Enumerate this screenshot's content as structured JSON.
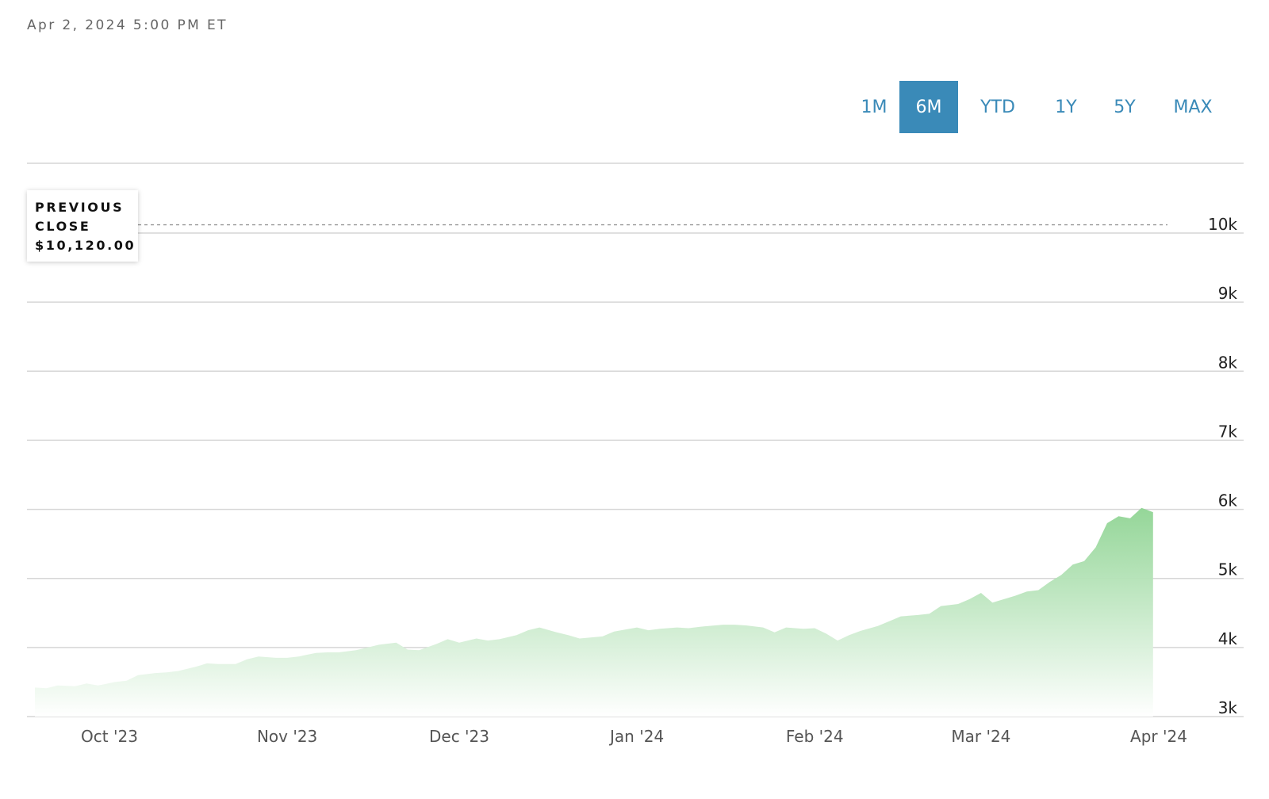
{
  "header": {
    "timestamp": "Apr 2, 2024 5:00 PM ET"
  },
  "range_tabs": [
    {
      "label": "1M",
      "active": false
    },
    {
      "label": "6M",
      "active": true
    },
    {
      "label": "YTD",
      "active": false
    },
    {
      "label": "1Y",
      "active": false
    },
    {
      "label": "5Y",
      "active": false
    },
    {
      "label": "MAX",
      "active": false
    }
  ],
  "tooltip": {
    "line1": "PREVIOUS",
    "line2": "CLOSE",
    "value": "$10,120.00"
  },
  "colors": {
    "accent": "#3a8ab8",
    "area_top": "#8fd493",
    "area_bottom": "#ffffff",
    "grid": "#d6d6d6",
    "reference_line": "#9a9a9a"
  },
  "chart_data": {
    "type": "area",
    "title": "",
    "xlabel": "",
    "ylabel": "",
    "ylim": [
      3000,
      11000
    ],
    "y_ticks": [
      3000,
      4000,
      5000,
      6000,
      7000,
      8000,
      9000,
      10000
    ],
    "y_tick_labels": [
      "3k",
      "4k",
      "5k",
      "6k",
      "7k",
      "8k",
      "9k",
      "10k"
    ],
    "x_ticks": [
      {
        "date": "2023-10-01",
        "label": "Oct '23"
      },
      {
        "date": "2023-11-01",
        "label": "Nov '23"
      },
      {
        "date": "2023-12-01",
        "label": "Dec '23"
      },
      {
        "date": "2024-01-01",
        "label": "Jan '24"
      },
      {
        "date": "2024-02-01",
        "label": "Feb '24"
      },
      {
        "date": "2024-03-01",
        "label": "Mar '24"
      },
      {
        "date": "2024-04-01",
        "label": "Apr '24"
      }
    ],
    "reference_line": {
      "label": "PREVIOUS CLOSE",
      "value": 10120
    },
    "grid": true,
    "series": [
      {
        "points": [
          [
            "2023-09-18",
            3420
          ],
          [
            "2023-09-20",
            3410
          ],
          [
            "2023-09-22",
            3450
          ],
          [
            "2023-09-25",
            3440
          ],
          [
            "2023-09-27",
            3480
          ],
          [
            "2023-09-29",
            3450
          ],
          [
            "2023-10-02",
            3500
          ],
          [
            "2023-10-04",
            3520
          ],
          [
            "2023-10-06",
            3600
          ],
          [
            "2023-10-09",
            3630
          ],
          [
            "2023-10-11",
            3640
          ],
          [
            "2023-10-13",
            3660
          ],
          [
            "2023-10-16",
            3720
          ],
          [
            "2023-10-18",
            3770
          ],
          [
            "2023-10-20",
            3760
          ],
          [
            "2023-10-23",
            3760
          ],
          [
            "2023-10-25",
            3830
          ],
          [
            "2023-10-27",
            3870
          ],
          [
            "2023-10-30",
            3850
          ],
          [
            "2023-11-01",
            3850
          ],
          [
            "2023-11-03",
            3870
          ],
          [
            "2023-11-06",
            3920
          ],
          [
            "2023-11-08",
            3930
          ],
          [
            "2023-11-10",
            3930
          ],
          [
            "2023-11-13",
            3960
          ],
          [
            "2023-11-15",
            4000
          ],
          [
            "2023-11-17",
            4040
          ],
          [
            "2023-11-20",
            4070
          ],
          [
            "2023-11-22",
            3970
          ],
          [
            "2023-11-24",
            3960
          ],
          [
            "2023-11-27",
            4050
          ],
          [
            "2023-11-29",
            4120
          ],
          [
            "2023-12-01",
            4070
          ],
          [
            "2023-12-04",
            4130
          ],
          [
            "2023-12-06",
            4100
          ],
          [
            "2023-12-08",
            4120
          ],
          [
            "2023-12-11",
            4180
          ],
          [
            "2023-12-13",
            4250
          ],
          [
            "2023-12-15",
            4290
          ],
          [
            "2023-12-18",
            4220
          ],
          [
            "2023-12-20",
            4180
          ],
          [
            "2023-12-22",
            4130
          ],
          [
            "2023-12-26",
            4160
          ],
          [
            "2023-12-28",
            4230
          ],
          [
            "2024-01-01",
            4290
          ],
          [
            "2024-01-03",
            4250
          ],
          [
            "2024-01-05",
            4270
          ],
          [
            "2024-01-08",
            4290
          ],
          [
            "2024-01-10",
            4280
          ],
          [
            "2024-01-12",
            4300
          ],
          [
            "2024-01-16",
            4330
          ],
          [
            "2024-01-18",
            4330
          ],
          [
            "2024-01-20",
            4320
          ],
          [
            "2024-01-23",
            4290
          ],
          [
            "2024-01-25",
            4220
          ],
          [
            "2024-01-27",
            4290
          ],
          [
            "2024-01-30",
            4270
          ],
          [
            "2024-02-01",
            4280
          ],
          [
            "2024-02-03",
            4200
          ],
          [
            "2024-02-05",
            4100
          ],
          [
            "2024-02-07",
            4180
          ],
          [
            "2024-02-09",
            4240
          ],
          [
            "2024-02-12",
            4310
          ],
          [
            "2024-02-14",
            4380
          ],
          [
            "2024-02-16",
            4450
          ],
          [
            "2024-02-19",
            4470
          ],
          [
            "2024-02-21",
            4490
          ],
          [
            "2024-02-23",
            4600
          ],
          [
            "2024-02-26",
            4630
          ],
          [
            "2024-02-28",
            4700
          ],
          [
            "2024-03-01",
            4790
          ],
          [
            "2024-03-03",
            4650
          ],
          [
            "2024-03-05",
            4700
          ],
          [
            "2024-03-07",
            4750
          ],
          [
            "2024-03-09",
            4810
          ],
          [
            "2024-03-11",
            4830
          ],
          [
            "2024-03-13",
            4950
          ],
          [
            "2024-03-15",
            5050
          ],
          [
            "2024-03-17",
            5200
          ],
          [
            "2024-03-19",
            5250
          ],
          [
            "2024-03-21",
            5450
          ],
          [
            "2024-03-23",
            5800
          ],
          [
            "2024-03-25",
            5900
          ],
          [
            "2024-03-27",
            5870
          ],
          [
            "2024-03-29",
            6020
          ],
          [
            "2024-03-31",
            5960
          ]
        ]
      }
    ]
  }
}
